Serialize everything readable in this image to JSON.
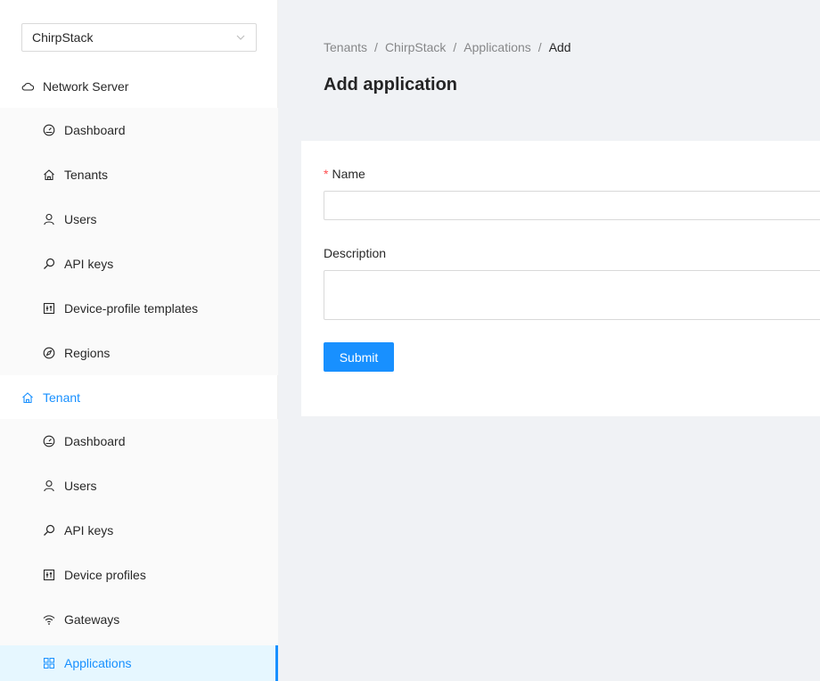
{
  "tenant_select": {
    "value": "ChirpStack"
  },
  "sidebar": {
    "network_server": {
      "title": "Network Server",
      "items": [
        {
          "label": "Dashboard",
          "icon": "dashboard-icon"
        },
        {
          "label": "Tenants",
          "icon": "home-icon"
        },
        {
          "label": "Users",
          "icon": "user-icon"
        },
        {
          "label": "API keys",
          "icon": "key-icon"
        },
        {
          "label": "Device-profile templates",
          "icon": "control-icon"
        },
        {
          "label": "Regions",
          "icon": "compass-icon"
        }
      ]
    },
    "tenant": {
      "title": "Tenant",
      "items": [
        {
          "label": "Dashboard",
          "icon": "dashboard-icon"
        },
        {
          "label": "Users",
          "icon": "user-icon"
        },
        {
          "label": "API keys",
          "icon": "key-icon"
        },
        {
          "label": "Device profiles",
          "icon": "control-icon"
        },
        {
          "label": "Gateways",
          "icon": "wifi-icon"
        },
        {
          "label": "Applications",
          "icon": "appstore-icon",
          "selected": true
        }
      ]
    }
  },
  "breadcrumb": [
    "Tenants",
    "ChirpStack",
    "Applications",
    "Add"
  ],
  "page_title": "Add application",
  "form": {
    "name_label": "Name",
    "name_value": "",
    "description_label": "Description",
    "description_value": "",
    "submit_label": "Submit"
  },
  "colors": {
    "primary": "#1890ff",
    "required": "#ff4d4f",
    "selected_bg": "#e6f7ff"
  }
}
